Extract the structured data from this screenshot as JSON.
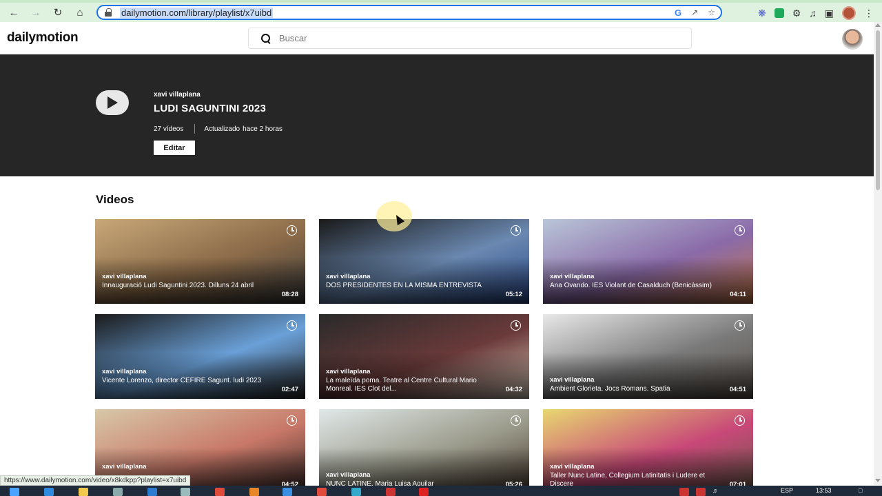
{
  "browser": {
    "url": "dailymotion.com/library/playlist/x7uibd",
    "status_link": "https://www.dailymotion.com/video/x8kdkpp?playlist=x7uibd"
  },
  "site": {
    "logo": "dailymotion",
    "search_placeholder": "Buscar"
  },
  "playlist": {
    "owner": "xavi villaplana",
    "title": "LUDI SAGUNTINI 2023",
    "videos_count": "27 vídeos",
    "updated_label": "Actualizado",
    "updated_time": "hace 2 horas",
    "edit_label": "Editar"
  },
  "videos_section": {
    "title": "Videos",
    "items": [
      {
        "owner": "xavi villaplana",
        "title": "Innauguració Ludi Saguntini 2023. Dilluns 24 abril",
        "duration": "08:28",
        "colors": [
          "#c8a878",
          "#8a6a48",
          "#3a3a3a"
        ]
      },
      {
        "owner": "xavi villaplana",
        "title": "DOS PRESIDENTES EN LA MISMA ENTREVISTA",
        "duration": "05:12",
        "colors": [
          "#1a1a1a",
          "#6a88b0",
          "#2b4a8a"
        ]
      },
      {
        "owner": "xavi villaplana",
        "title": "Ana Ovando. IES Violant de Casalduch (Benicàssim)",
        "duration": "04:11",
        "colors": [
          "#b9c6d8",
          "#8a6aa8",
          "#c87848"
        ]
      },
      {
        "owner": "xavi villaplana",
        "title": "Vicente Lorenzo, director CEFIRE Sagunt. ludi 2023",
        "duration": "02:47",
        "colors": [
          "#1a1a1a",
          "#6aa0d8",
          "#2a2a2a"
        ]
      },
      {
        "owner": "xavi villaplana",
        "title": "La maleïda poma. Teatre al Centre Cultural Mario Monreal. IES Clot del...",
        "duration": "04:32",
        "colors": [
          "#2a2a2a",
          "#6a3a3a",
          "#d8c8b8"
        ]
      },
      {
        "owner": "xavi villaplana",
        "title": "Ambient Glorieta. Jocs Romans. Spatia",
        "duration": "04:51",
        "colors": [
          "#e8e8e8",
          "#7a7a7a",
          "#5a5048"
        ]
      },
      {
        "owner": "xavi villaplana",
        "title": "",
        "duration": "04:52",
        "colors": [
          "#d8c8a8",
          "#c87868",
          "#3a2a28"
        ]
      },
      {
        "owner": "xavi villaplana",
        "title": "NUNC LATINE. Maria Luisa Aguilar",
        "duration": "05:26",
        "colors": [
          "#e0e8e8",
          "#9a9a8a",
          "#4a3a30"
        ]
      },
      {
        "owner": "xavi villaplana",
        "title": "Taller Nunc Latine, Collegium Latinitatis i Ludere et Discere",
        "duration": "07:01",
        "colors": [
          "#e8d870",
          "#c84878",
          "#6a5a4a"
        ]
      }
    ]
  },
  "taskbar": {
    "language": "ESP",
    "time": "13:53"
  }
}
